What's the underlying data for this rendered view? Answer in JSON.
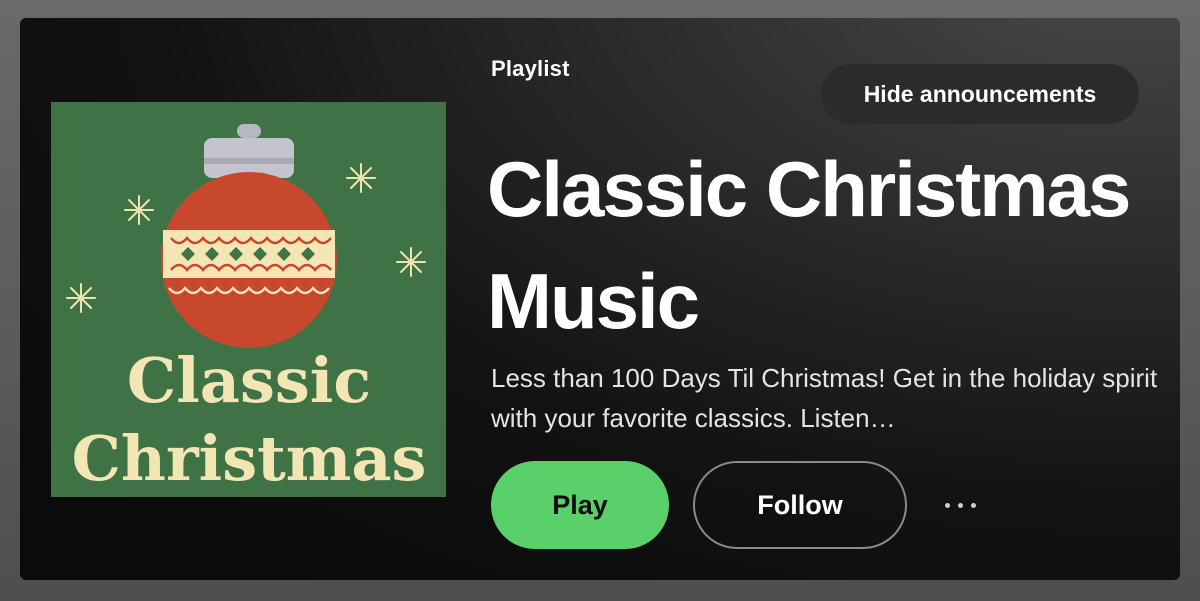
{
  "playlist": {
    "type_label": "Playlist",
    "title": "Classic Christmas Music",
    "description": "Less than 100 Days Til Christmas! Get in the holiday spirit with your favorite classics. Listen…",
    "cover": {
      "line1": "Classic",
      "line2": "Christmas",
      "background_color": "#3f7346",
      "ornament_color": "#c8482e",
      "cream_color": "#f3e6b4"
    }
  },
  "announcement": {
    "hide_label": "Hide announcements"
  },
  "actions": {
    "play_label": "Play",
    "follow_label": "Follow",
    "more_icon": "more-horizontal-icon"
  },
  "colors": {
    "play_green": "#5ad06a",
    "card_background": "#121212"
  }
}
